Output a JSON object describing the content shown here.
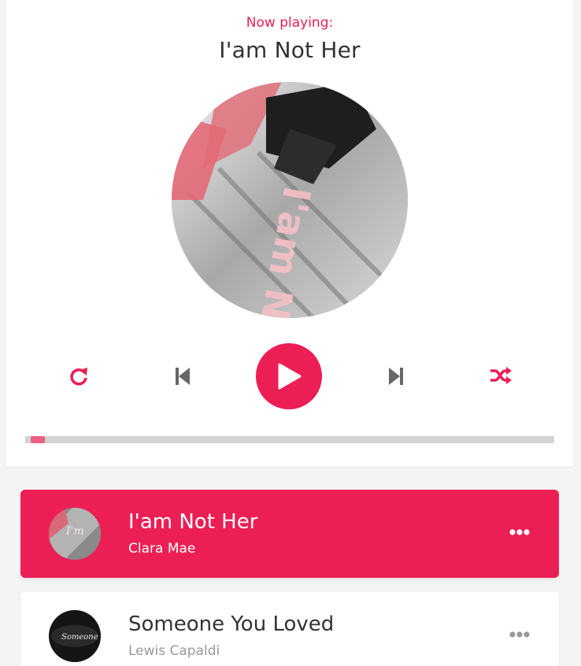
{
  "dashboard": {
    "now_playing_label": "Now playing:",
    "current_song": "I'am Not Her",
    "cd_art_text": "I'am No",
    "progress_fraction": 0.01
  },
  "controls": {
    "repeat_icon": "redo-icon",
    "prev_icon": "step-backward-icon",
    "play_icon": "play-icon",
    "next_icon": "step-forward-icon",
    "random_icon": "random-icon"
  },
  "playlist": [
    {
      "name": "I'am Not Her",
      "singer": "Clara Mae",
      "active": true,
      "thumb_text": "I'm"
    },
    {
      "name": "Someone You Loved",
      "singer": "Lewis Capaldi",
      "active": false,
      "thumb_text": "Someone U"
    }
  ],
  "colors": {
    "accent": "#ec1f55",
    "text_dark": "#333333",
    "text_muted": "#999999",
    "progress_track": "#d3d3d3",
    "progress_thumb": "#ec5f86"
  }
}
